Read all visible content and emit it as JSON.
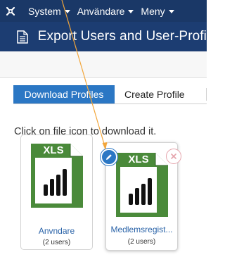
{
  "nav": {
    "items": [
      {
        "label": "System"
      },
      {
        "label": "Användare"
      },
      {
        "label": "Meny"
      }
    ]
  },
  "header": {
    "title": "Export Users and User-Profi"
  },
  "tabs": [
    {
      "label": "Download Profiles",
      "active": true
    },
    {
      "label": "Create Profile",
      "active": false
    }
  ],
  "instruction": "Click on file icon to download it.",
  "cards": [
    {
      "icon_text": "XLS",
      "name": "Anvndare",
      "count": "(2 users)"
    },
    {
      "icon_text": "XLS",
      "name": "Medlemsregist...",
      "count": "(2 users)"
    }
  ],
  "colors": {
    "nav_bg": "#1a3867",
    "header_bg": "#1c3d72",
    "tab_active": "#2b77c4",
    "xls_green": "#4a8a3a",
    "link": "#2a63a8",
    "annotation_arrow": "#f2a63b"
  }
}
